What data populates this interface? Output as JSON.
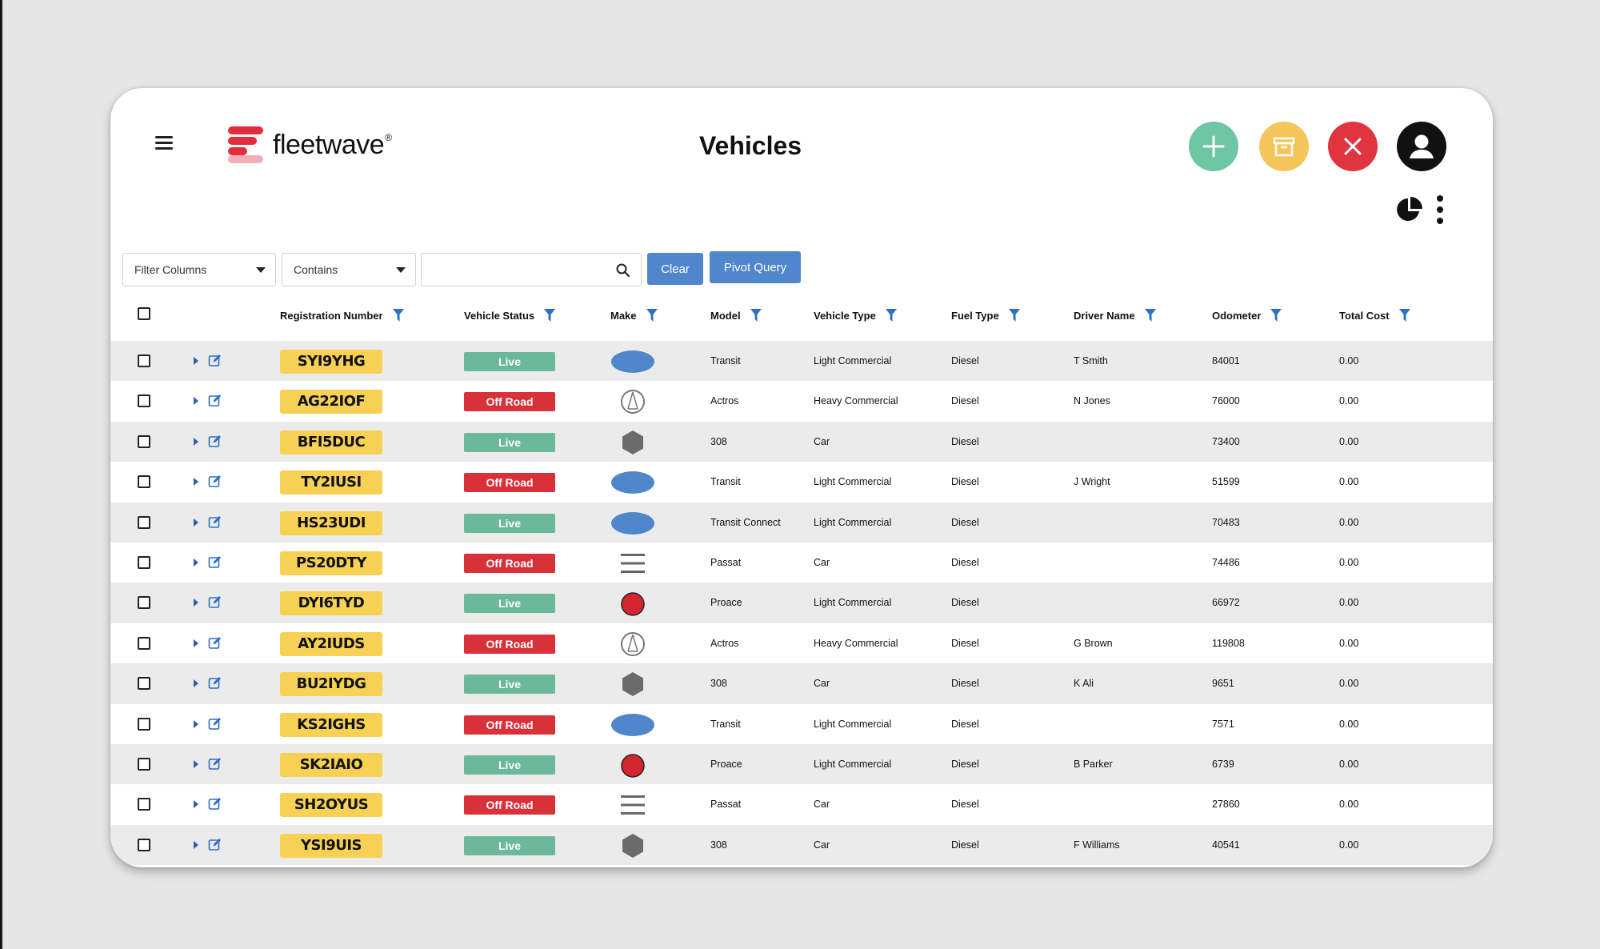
{
  "app": {
    "brand": "fleetwave",
    "brand_mark": "®",
    "page_title": "Vehicles"
  },
  "header_actions": [
    {
      "name": "add-button",
      "icon": "plus-icon",
      "color": "#6ec6a2"
    },
    {
      "name": "archive-button",
      "icon": "archive-icon",
      "color": "#f4c55b"
    },
    {
      "name": "close-button",
      "icon": "close-icon",
      "color": "#e0353f"
    },
    {
      "name": "user-button",
      "icon": "user-icon",
      "color": "#111111"
    }
  ],
  "toolbar": {
    "filter_columns": "Filter Columns",
    "condition": "Contains",
    "search_value": "",
    "clear_label": "Clear",
    "pivot_label": "Pivot Query"
  },
  "columns": {
    "registration": "Registration Number",
    "status": "Vehicle Status",
    "make": "Make",
    "model": "Model",
    "type": "Vehicle Type",
    "fuel": "Fuel Type",
    "driver": "Driver Name",
    "odometer": "Odometer",
    "cost": "Total Cost"
  },
  "status_colors": {
    "Live": "#6bb89b",
    "Off Road": "#d8313a"
  },
  "make_icons": {
    "ford": "ford-oval-icon",
    "mercedes": "mercedes-star-icon",
    "peugeot": "peugeot-hexagon-icon",
    "vw": "vw-lines-icon",
    "toyota": "toyota-circle-icon"
  },
  "rows": [
    {
      "reg": "SYI9YHG",
      "status": "Live",
      "make": "ford",
      "model": "Transit",
      "type": "Light Commercial",
      "fuel": "Diesel",
      "driver": "T Smith",
      "odometer": "84001",
      "cost": "0.00"
    },
    {
      "reg": "AG22IOF",
      "status": "Off Road",
      "make": "mercedes",
      "model": "Actros",
      "type": "Heavy Commercial",
      "fuel": "Diesel",
      "driver": "N Jones",
      "odometer": "76000",
      "cost": "0.00"
    },
    {
      "reg": "BFI5DUC",
      "status": "Live",
      "make": "peugeot",
      "model": "308",
      "type": "Car",
      "fuel": "Diesel",
      "driver": "",
      "odometer": "73400",
      "cost": "0.00"
    },
    {
      "reg": "TY2IUSI",
      "status": "Off Road",
      "make": "ford",
      "model": "Transit",
      "type": "Light Commercial",
      "fuel": "Diesel",
      "driver": "J Wright",
      "odometer": "51599",
      "cost": "0.00"
    },
    {
      "reg": "HS23UDI",
      "status": "Live",
      "make": "ford",
      "model": "Transit Connect",
      "type": "Light Commercial",
      "fuel": "Diesel",
      "driver": "",
      "odometer": "70483",
      "cost": "0.00"
    },
    {
      "reg": "PS20DTY",
      "status": "Off Road",
      "make": "vw",
      "model": "Passat",
      "type": "Car",
      "fuel": "Diesel",
      "driver": "",
      "odometer": "74486",
      "cost": "0.00"
    },
    {
      "reg": "DYI6TYD",
      "status": "Live",
      "make": "toyota",
      "model": "Proace",
      "type": "Light Commercial",
      "fuel": "Diesel",
      "driver": "",
      "odometer": "66972",
      "cost": "0.00"
    },
    {
      "reg": "AY2IUDS",
      "status": "Off Road",
      "make": "mercedes",
      "model": "Actros",
      "type": "Heavy Commercial",
      "fuel": "Diesel",
      "driver": "G Brown",
      "odometer": "119808",
      "cost": "0.00"
    },
    {
      "reg": "BU2IYDG",
      "status": "Live",
      "make": "peugeot",
      "model": "308",
      "type": "Car",
      "fuel": "Diesel",
      "driver": "K Ali",
      "odometer": "9651",
      "cost": "0.00"
    },
    {
      "reg": "KS2IGHS",
      "status": "Off Road",
      "make": "ford",
      "model": "Transit",
      "type": "Light Commercial",
      "fuel": "Diesel",
      "driver": "",
      "odometer": "7571",
      "cost": "0.00"
    },
    {
      "reg": "SK2IAIO",
      "status": "Live",
      "make": "toyota",
      "model": "Proace",
      "type": "Light Commercial",
      "fuel": "Diesel",
      "driver": "B Parker",
      "odometer": "6739",
      "cost": "0.00"
    },
    {
      "reg": "SH2OYUS",
      "status": "Off Road",
      "make": "vw",
      "model": "Passat",
      "type": "Car",
      "fuel": "Diesel",
      "driver": "",
      "odometer": "27860",
      "cost": "0.00"
    },
    {
      "reg": "YSI9UIS",
      "status": "Live",
      "make": "peugeot",
      "model": "308",
      "type": "Car",
      "fuel": "Diesel",
      "driver": "F Williams",
      "odometer": "40541",
      "cost": "0.00"
    }
  ]
}
